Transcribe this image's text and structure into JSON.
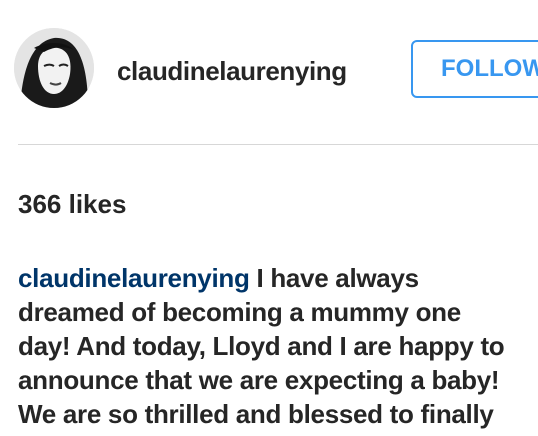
{
  "post": {
    "username": "claudinelaurenying",
    "follow_label": "FOLLOW",
    "likes": "366 likes",
    "caption": {
      "author": "claudinelaurenying",
      "first_line_text": " I have always",
      "lines": [
        "dreamed of becoming a mummy one",
        "day! And today, Lloyd and I are happy to",
        "announce that we are expecting a baby!",
        "We are so thrilled and blessed to finally"
      ]
    }
  },
  "colors": {
    "accent": "#3897f0",
    "author_link": "#003569",
    "text": "#262626",
    "divider": "#d7d7d7"
  },
  "icons": {
    "avatar": "profile-photo"
  }
}
